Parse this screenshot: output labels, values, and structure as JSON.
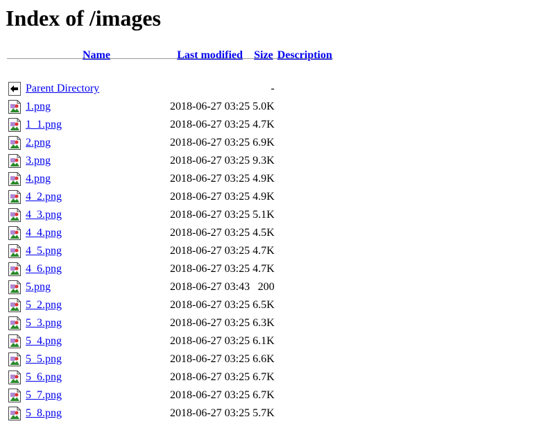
{
  "page": {
    "title": "Index of /images"
  },
  "columns": {
    "name": "Name",
    "last_modified": "Last modified",
    "size": "Size",
    "description": "Description"
  },
  "parent": {
    "label": "Parent Directory",
    "size": "-",
    "icon": "back-icon"
  },
  "files": [
    {
      "name": "1.png",
      "modified": "2018-06-27 03:25",
      "size": "5.0K",
      "icon": "image-icon"
    },
    {
      "name": "1_1.png",
      "modified": "2018-06-27 03:25",
      "size": "4.7K",
      "icon": "image-icon"
    },
    {
      "name": "2.png",
      "modified": "2018-06-27 03:25",
      "size": "6.9K",
      "icon": "image-icon"
    },
    {
      "name": "3.png",
      "modified": "2018-06-27 03:25",
      "size": "9.3K",
      "icon": "image-icon"
    },
    {
      "name": "4.png",
      "modified": "2018-06-27 03:25",
      "size": "4.9K",
      "icon": "image-icon"
    },
    {
      "name": "4_2.png",
      "modified": "2018-06-27 03:25",
      "size": "4.9K",
      "icon": "image-icon"
    },
    {
      "name": "4_3.png",
      "modified": "2018-06-27 03:25",
      "size": "5.1K",
      "icon": "image-icon"
    },
    {
      "name": "4_4.png",
      "modified": "2018-06-27 03:25",
      "size": "4.5K",
      "icon": "image-icon"
    },
    {
      "name": "4_5.png",
      "modified": "2018-06-27 03:25",
      "size": "4.7K",
      "icon": "image-icon"
    },
    {
      "name": "4_6.png",
      "modified": "2018-06-27 03:25",
      "size": "4.7K",
      "icon": "image-icon"
    },
    {
      "name": "5.png",
      "modified": "2018-06-27 03:43",
      "size": "200",
      "icon": "image-icon"
    },
    {
      "name": "5_2.png",
      "modified": "2018-06-27 03:25",
      "size": "6.5K",
      "icon": "image-icon"
    },
    {
      "name": "5_3.png",
      "modified": "2018-06-27 03:25",
      "size": "6.3K",
      "icon": "image-icon"
    },
    {
      "name": "5_4.png",
      "modified": "2018-06-27 03:25",
      "size": "6.1K",
      "icon": "image-icon"
    },
    {
      "name": "5_5.png",
      "modified": "2018-06-27 03:25",
      "size": "6.6K",
      "icon": "image-icon"
    },
    {
      "name": "5_6.png",
      "modified": "2018-06-27 03:25",
      "size": "6.7K",
      "icon": "image-icon"
    },
    {
      "name": "5_7.png",
      "modified": "2018-06-27 03:25",
      "size": "6.7K",
      "icon": "image-icon"
    },
    {
      "name": "5_8.png",
      "modified": "2018-06-27 03:25",
      "size": "5.7K",
      "icon": "image-icon"
    }
  ],
  "colors": {
    "link": "#0000ee",
    "rule": "#9a9a9a"
  }
}
